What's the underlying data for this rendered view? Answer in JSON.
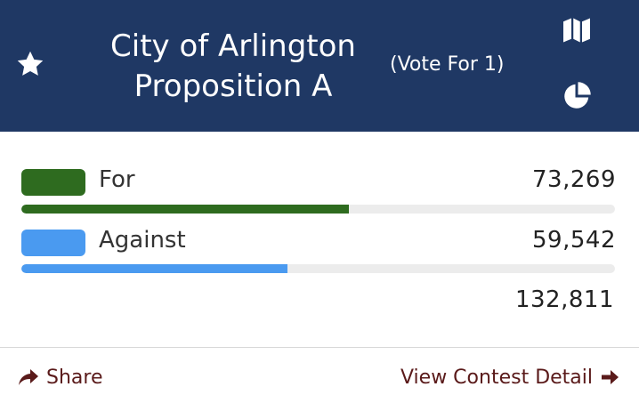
{
  "header": {
    "title_line1": "City of Arlington",
    "title_line2": "Proposition A",
    "vote_for": "(Vote For 1)",
    "background_color": "#1f3864",
    "icons": {
      "favorite": "star-icon",
      "map": "map-icon",
      "chart": "pie-chart-icon"
    }
  },
  "choices": [
    {
      "name": "For",
      "votes": "73,269",
      "share": 0.5517,
      "color": "#2e6b1f"
    },
    {
      "name": "Against",
      "votes": "59,542",
      "share": 0.4483,
      "color": "#4a9af0"
    }
  ],
  "total_votes": "132,811",
  "footer": {
    "share_label": "Share",
    "detail_label": "View Contest Detail",
    "link_color": "#5a1a1a",
    "icons": {
      "share": "share-arrow-icon",
      "detail": "arrow-right-icon"
    }
  }
}
